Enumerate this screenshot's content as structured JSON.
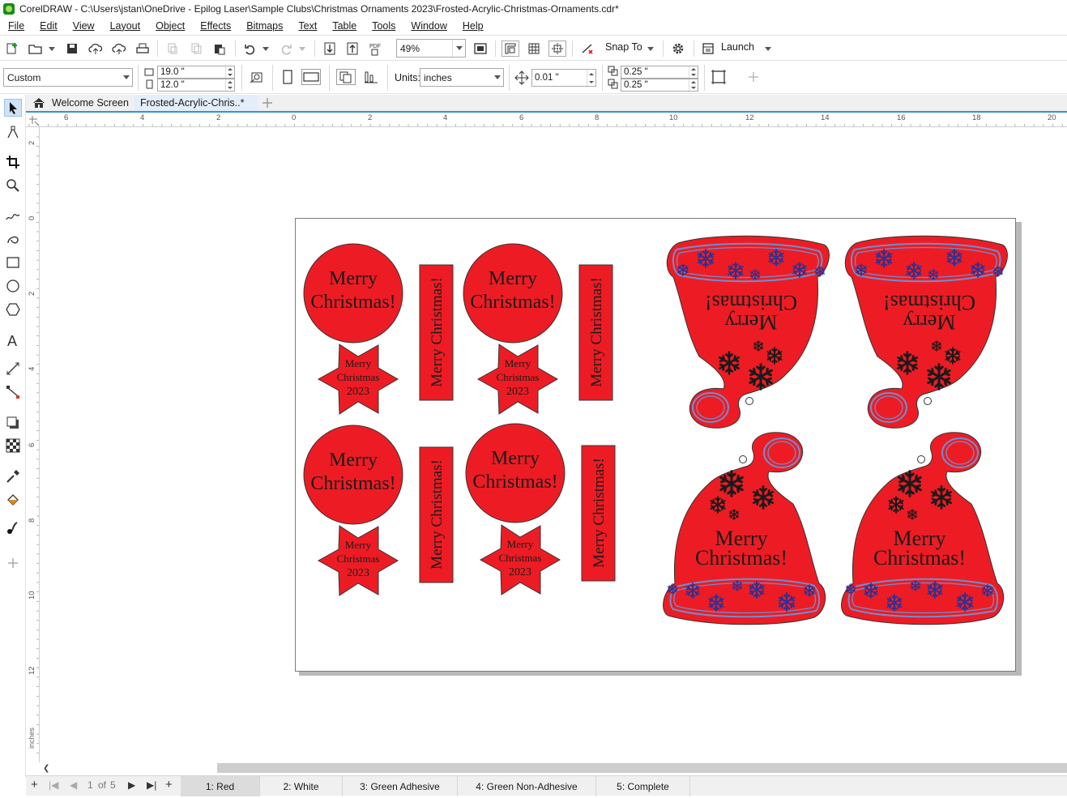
{
  "window": {
    "title": "CorelDRAW - C:\\Users\\jstan\\OneDrive - Epilog Laser\\Sample Clubs\\Christmas Ornaments 2023\\Frosted-Acrylic-Christmas-Ornaments.cdr*"
  },
  "menu": [
    "File",
    "Edit",
    "View",
    "Layout",
    "Object",
    "Effects",
    "Bitmaps",
    "Text",
    "Table",
    "Tools",
    "Window",
    "Help"
  ],
  "toolbar": {
    "zoom": "49%",
    "snap_to": "Snap To",
    "launch": "Launch"
  },
  "propbar": {
    "page_preset": "Custom",
    "width": "19.0 \"",
    "height": "12.0 \"",
    "units_label": "Units:",
    "units": "inches",
    "nudge": "0.01 \"",
    "dup_x": "0.25 \"",
    "dup_y": "0.25 \""
  },
  "tabs": {
    "welcome": "Welcome Screen",
    "document": "Frosted-Acrylic-Chris..*"
  },
  "ruler": {
    "h_labels": [
      "6",
      "4",
      "2",
      "0",
      "2",
      "4",
      "6",
      "8",
      "10",
      "12",
      "14",
      "16",
      "18",
      "20"
    ],
    "v_labels": [
      "2",
      "0",
      "2",
      "4",
      "6",
      "8",
      "10",
      "12"
    ],
    "units_caption": "inches"
  },
  "artwork": {
    "circle_text_1": "Merry",
    "circle_text_2": "Christmas!",
    "star_text_1": "Merry",
    "star_text_2": "Christmas",
    "star_text_3": "2023",
    "rect_text": "Merry Christmas!",
    "hat_text_1": "Merry",
    "hat_text_2": "Christmas!",
    "colors": {
      "red": "#ed1c24",
      "blue_snow": "#2e3192",
      "black_snow": "#1a1a1a",
      "outline_blue": "#6d8fd1"
    }
  },
  "pagenav": {
    "counter_current": "1",
    "counter_of": "of",
    "counter_total": "5",
    "pages": [
      "1: Red",
      "2: White",
      "3: Green Adhesive",
      "4: Green Non-Adhesive",
      "5: Complete"
    ]
  }
}
